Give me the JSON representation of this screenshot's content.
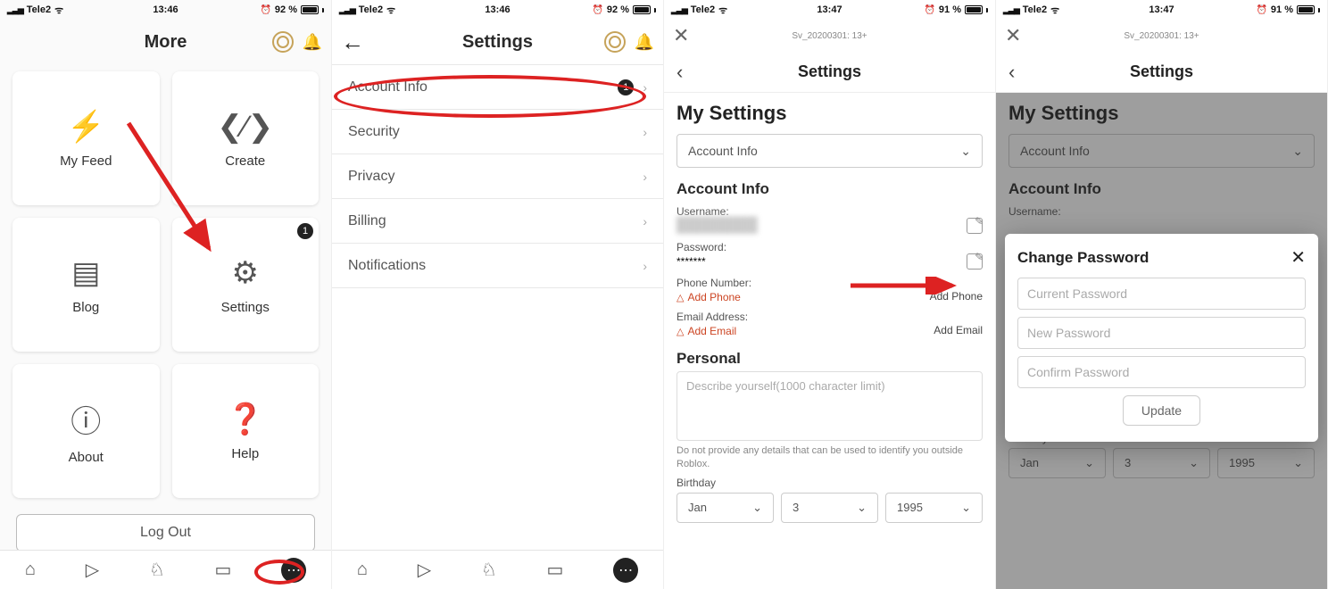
{
  "status": {
    "carrier": "Tele2",
    "time1": "13:46",
    "time2": "13:47",
    "batt1": "92 %",
    "batt2": "91 %"
  },
  "screen1": {
    "title": "More",
    "tiles": [
      {
        "label": "My Feed"
      },
      {
        "label": "Create"
      },
      {
        "label": "Blog"
      },
      {
        "label": "Settings",
        "badge": "1"
      },
      {
        "label": "About"
      },
      {
        "label": "Help"
      }
    ],
    "logout": "Log Out"
  },
  "screen2": {
    "title": "Settings",
    "rows": [
      {
        "label": "Account Info",
        "badge": "1"
      },
      {
        "label": "Security"
      },
      {
        "label": "Privacy"
      },
      {
        "label": "Billing"
      },
      {
        "label": "Notifications"
      }
    ]
  },
  "screen3": {
    "user_tag": "Sv_20200301: 13+",
    "nav_title": "Settings",
    "h1": "My Settings",
    "dropdown": "Account Info",
    "section": "Account Info",
    "username_label": "Username:",
    "password_label": "Password:",
    "password_value": "*******",
    "phone_label": "Phone Number:",
    "add_phone_warn": "Add Phone",
    "add_phone_action": "Add Phone",
    "email_label": "Email Address:",
    "add_email_warn": "Add Email",
    "add_email_action": "Add Email",
    "personal": "Personal",
    "describe_ph": "Describe yourself(1000 character limit)",
    "hint": "Do not provide any details that can be used to identify you outside Roblox.",
    "birthday_label": "Birthday",
    "bmonth": "Jan",
    "bday": "3",
    "byear": "1995"
  },
  "screen4": {
    "modal_title": "Change Password",
    "ph_current": "Current Password",
    "ph_new": "New Password",
    "ph_confirm": "Confirm Password",
    "update": "Update"
  }
}
